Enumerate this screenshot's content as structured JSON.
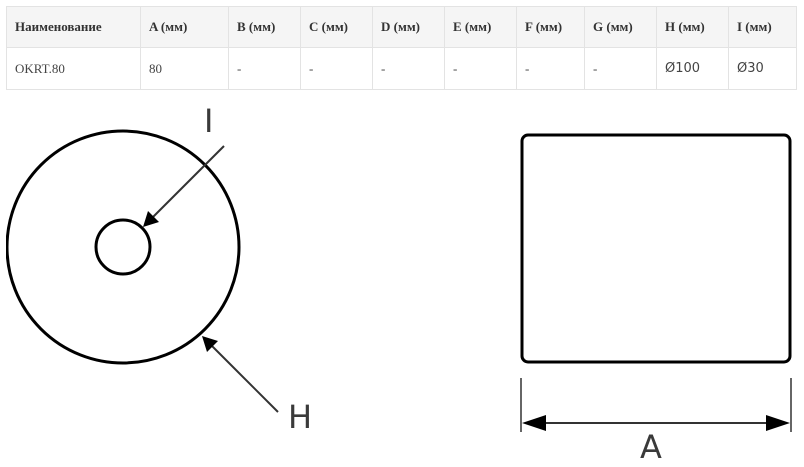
{
  "table": {
    "headers": [
      "Наименование",
      "A (мм)",
      "B (мм)",
      "C (мм)",
      "D (мм)",
      "E (мм)",
      "F (мм)",
      "G (мм)",
      "H (мм)",
      "I  (мм)"
    ],
    "rows": [
      [
        "OKRT.80",
        "80",
        "-",
        "-",
        "-",
        "-",
        "-",
        "-",
        "Ø100",
        "Ø30"
      ]
    ]
  },
  "drawing": {
    "label_inner_diameter": "I",
    "label_outer_diameter": "H",
    "label_length": "A"
  }
}
